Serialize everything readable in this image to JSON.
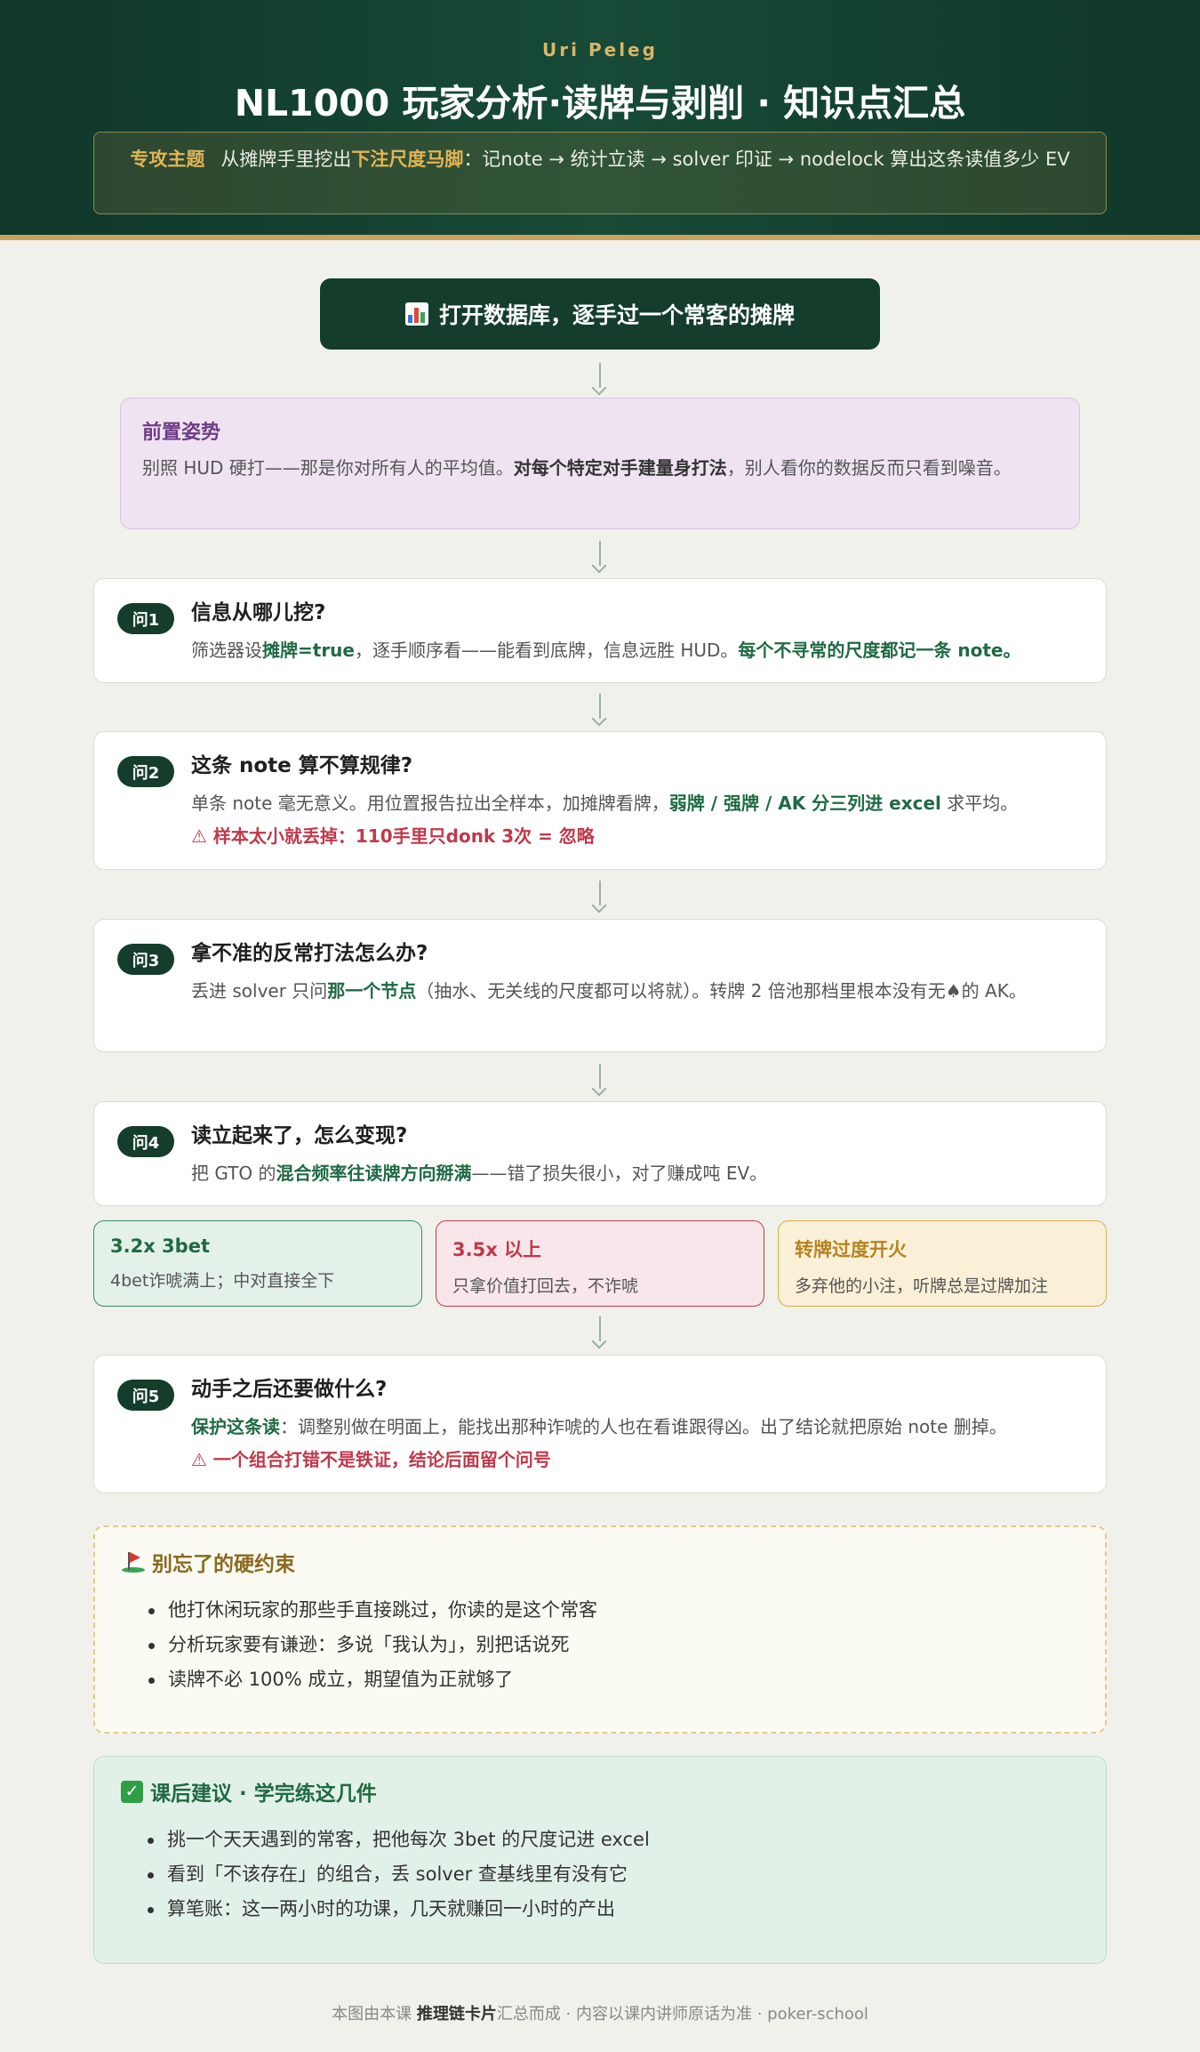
{
  "header": {
    "author": "Uri Peleg",
    "title": "NL1000 玩家分析·读牌与剥削 · 知识点汇总",
    "theme_label": "专攻主题",
    "theme_pre": "从摊牌手里挖出",
    "theme_highlight": "下注尺度马脚",
    "theme_post": "：记note → 统计立读 → solver 印证 → nodelock 算出这条读值多少 EV"
  },
  "start": {
    "icon": "bar-chart-icon",
    "label": "打开数据库，逐手过一个常客的摊牌"
  },
  "pre": {
    "title": "前置姿势",
    "text_a": "别照 HUD 硬打——那是你对所有人的平均值。",
    "text_b": "对每个特定对手建量身打法",
    "text_c": "，别人看你的数据反而只看到噪音。"
  },
  "questions": [
    {
      "badge": "问1",
      "title": "信息从哪儿挖?",
      "t1": "筛选器设",
      "b1": "摊牌=true",
      "t2": "，逐手顺序看——能看到底牌，信息远胜 HUD。",
      "b2": "每个不寻常的尺度都记一条 note。"
    },
    {
      "badge": "问2",
      "title": "这条 note 算不算规律?",
      "t1": "单条 note 毫无意义。用位置报告拉出全样本，加摊牌看牌，",
      "b1": "弱牌 / 强牌 / AK 分三列进 excel",
      "t2": " 求平均。",
      "warn": "⚠ 样本太小就丢掉：110手里只donk 3次 = 忽略"
    },
    {
      "badge": "问3",
      "title": "拿不准的反常打法怎么办?",
      "t1": "丢进 solver 只问",
      "b1": "那一个节点",
      "t2": "（抽水、无关线的尺度都可以将就）。转牌 2 倍池那档里根本没有无♠的 AK。"
    },
    {
      "badge": "问4",
      "title": "读立起来了，怎么变现?",
      "t1": "把 GTO 的",
      "b1": "混合频率往读牌方向掰满",
      "t2": "——错了损失很小，对了赚成吨 EV。"
    },
    {
      "badge": "问5",
      "title": "动手之后还要做什么?",
      "b1": "保护这条读",
      "t1": "：调整别做在明面上，能找出那种诈唬的人也在看谁跟得凶。出了结论就把原始 note 删掉。",
      "warn": "⚠ 一个组合打错不是铁证，结论后面留个问号"
    }
  ],
  "outcomes": [
    {
      "title": "3.2x 3bet",
      "desc": "4bet诈唬满上；中对直接全下"
    },
    {
      "title": "3.5x 以上",
      "desc": "只拿价值打回去，不诈唬"
    },
    {
      "title": "转牌过度开火",
      "desc": "多弃他的小注，听牌总是过牌加注"
    }
  ],
  "rules": {
    "icon": "golf-flag-icon",
    "title": "别忘了的硬约束",
    "items": [
      "他打休闲玩家的那些手直接跳过，你读的是这个常客",
      "分析玩家要有谦逊：多说「我认为」，别把话说死",
      "读牌不必 100% 成立，期望值为正就够了"
    ]
  },
  "homework": {
    "icon": "check-icon",
    "title": "课后建议 · 学完练这几件",
    "items": [
      "挑一个天天遇到的常客，把他每次 3bet 的尺度记进 excel",
      "看到「不该存在」的组合，丢 solver 查基线里有没有它",
      "算笔账：这一两小时的功课，几天就赚回一小时的产出"
    ]
  },
  "footer": {
    "pre": "本图由本课 ",
    "bold": "推理链卡片",
    "post": "汇总而成 · 内容以课内讲师原话为准 · poker-school"
  }
}
